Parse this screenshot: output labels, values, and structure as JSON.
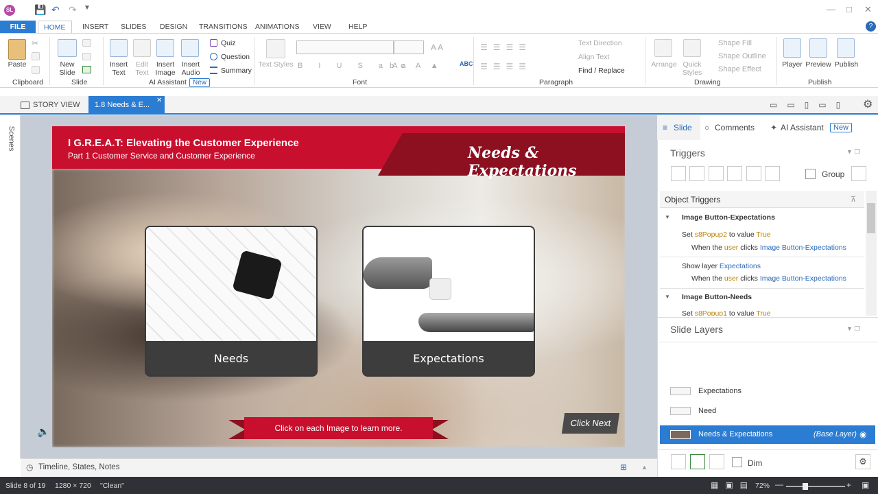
{
  "titlebar": {
    "logo": "SL",
    "icons": [
      "save-icon",
      "undo-icon",
      "redo-icon",
      "customize-icon"
    ]
  },
  "menu": {
    "tabs": [
      "FILE",
      "HOME",
      "INSERT",
      "SLIDES",
      "DESIGN",
      "TRANSITIONS",
      "ANIMATIONS",
      "VIEW",
      "HELP"
    ]
  },
  "ribbon": {
    "clipboard": {
      "paste": "Paste",
      "group": "Clipboard"
    },
    "slide": {
      "new_slide": "New Slide",
      "group": "Slide"
    },
    "ai": {
      "insert_text": "Insert Text",
      "edit_text": "Edit Text",
      "insert_image": "Insert Image",
      "insert_audio": "Insert Audio",
      "quiz": "Quiz",
      "question": "Question",
      "summary": "Summary",
      "group": "AI Assistant",
      "new": "New"
    },
    "font": {
      "text_styles": "Text Styles",
      "group": "Font"
    },
    "paragraph": {
      "text_direction": "Text Direction",
      "align_text": "Align Text",
      "find_replace": "Find / Replace",
      "group": "Paragraph"
    },
    "drawing": {
      "arrange": "Arrange",
      "quick_styles": "Quick Styles",
      "shape_fill": "Shape Fill",
      "shape_outline": "Shape Outline",
      "shape_effect": "Shape Effect",
      "group": "Drawing"
    },
    "publish": {
      "player": "Player",
      "preview": "Preview",
      "publish": "Publish",
      "group": "Publish"
    }
  },
  "doctabs": {
    "story_view": "STORY VIEW",
    "current": "1.8 Needs & E..."
  },
  "scenes": "Scenes",
  "slide": {
    "title": "I G.R.E.A.T: Elevating the Customer Experience",
    "subtitle": "Part 1 Customer Service and Customer Experience",
    "heading": "Needs & Expectations",
    "card1": "Needs",
    "card2": "Expectations",
    "banner": "Click on each Image to learn more.",
    "next": "Click Next"
  },
  "timeline": {
    "label": "Timeline, States, Notes"
  },
  "panel": {
    "tabs": {
      "slide": "Slide",
      "comments": "Comments",
      "ai": "AI Assistant",
      "new": "New"
    },
    "triggers": "Triggers",
    "group": "Group",
    "object_triggers": "Object Triggers",
    "trigger_groups": [
      {
        "name": "Image Button-Expectations",
        "items": [
          {
            "action": "Set",
            "var": "s8Popup2",
            "mid": "to value",
            "val": "True",
            "when": "When the",
            "who": "user",
            "verb": "clicks",
            "obj": "Image Button-Expectations"
          },
          {
            "action": "Show layer",
            "var": "Expectations",
            "mid": "",
            "val": "",
            "when": "When the",
            "who": "user",
            "verb": "clicks",
            "obj": "Image Button-Expectations"
          }
        ]
      },
      {
        "name": "Image Button-Needs",
        "items": [
          {
            "action": "Set",
            "var": "s8Popup1",
            "mid": "to value",
            "val": "True"
          }
        ]
      }
    ],
    "slide_layers": "Slide Layers",
    "layers": [
      {
        "name": "Expectations"
      },
      {
        "name": "Need"
      },
      {
        "name": "Needs & Expectations",
        "base": "(Base Layer)"
      }
    ],
    "dim": "Dim"
  },
  "status": {
    "slide": "Slide 8 of 19",
    "size": "1280 × 720",
    "theme": "\"Clean\"",
    "zoom": "72%"
  }
}
